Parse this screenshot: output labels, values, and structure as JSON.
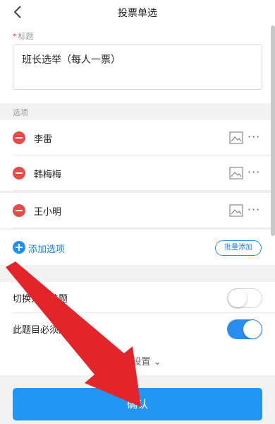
{
  "header": {
    "title": "投票单选"
  },
  "title_field": {
    "required_mark": "*",
    "label": "标题",
    "value": "班长选举（每人一票）"
  },
  "options_section": {
    "label": "选项"
  },
  "options": [
    {
      "label": "李雷"
    },
    {
      "label": "韩梅梅"
    },
    {
      "label": "王小明"
    }
  ],
  "add_option": {
    "label": "添加选项",
    "batch_label": "批量添加"
  },
  "settings_section": {
    "label": "设置"
  },
  "settings": [
    {
      "label": "切换为多选题",
      "on": false
    },
    {
      "label": "此题目必须回答",
      "on": true
    }
  ],
  "more_settings": {
    "label": "编辑设置 ⌄"
  },
  "confirm": {
    "label": "确认"
  },
  "colors": {
    "accent": "#2196f3",
    "danger": "#e84a4a",
    "annotation_arrow": "#e3242b"
  }
}
